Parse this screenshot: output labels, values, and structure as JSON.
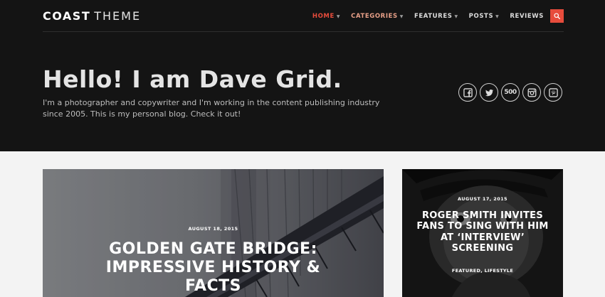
{
  "logo": {
    "bold": "COAST",
    "light": "THEME"
  },
  "nav": {
    "items": [
      {
        "label": "HOME",
        "dropdown": true
      },
      {
        "label": "CATEGORIES",
        "dropdown": true
      },
      {
        "label": "FEATURES",
        "dropdown": true
      },
      {
        "label": "POSTS",
        "dropdown": true
      },
      {
        "label": "REVIEWS",
        "dropdown": false
      }
    ],
    "search_icon": "search-icon"
  },
  "hero": {
    "title": "Hello! I am Dave Grid.",
    "description": "I'm a photographer and copywriter and I'm working in the content publishing industry since 2005. This is my personal blog. Check it out!"
  },
  "socials": {
    "icons": [
      "facebook-icon",
      "twitter-icon",
      "500px-icon",
      "instagram-icon",
      "pinterest-icon"
    ],
    "px500_label": "500"
  },
  "posts": [
    {
      "date": "AUGUST 18, 2015",
      "title": "GOLDEN GATE BRIDGE: IMPRESSIVE HISTORY & FACTS"
    },
    {
      "date": "AUGUST 17, 2015",
      "title": "ROGER SMITH INVITES FANS TO SING WITH HIM AT ‘INTERVIEW’ SCREENING",
      "tags": "FEATURED, LIFESTYLE"
    }
  ],
  "colors": {
    "accent": "#e74c3c",
    "header_bg": "#141414",
    "page_bg": "#f3f3f3"
  }
}
